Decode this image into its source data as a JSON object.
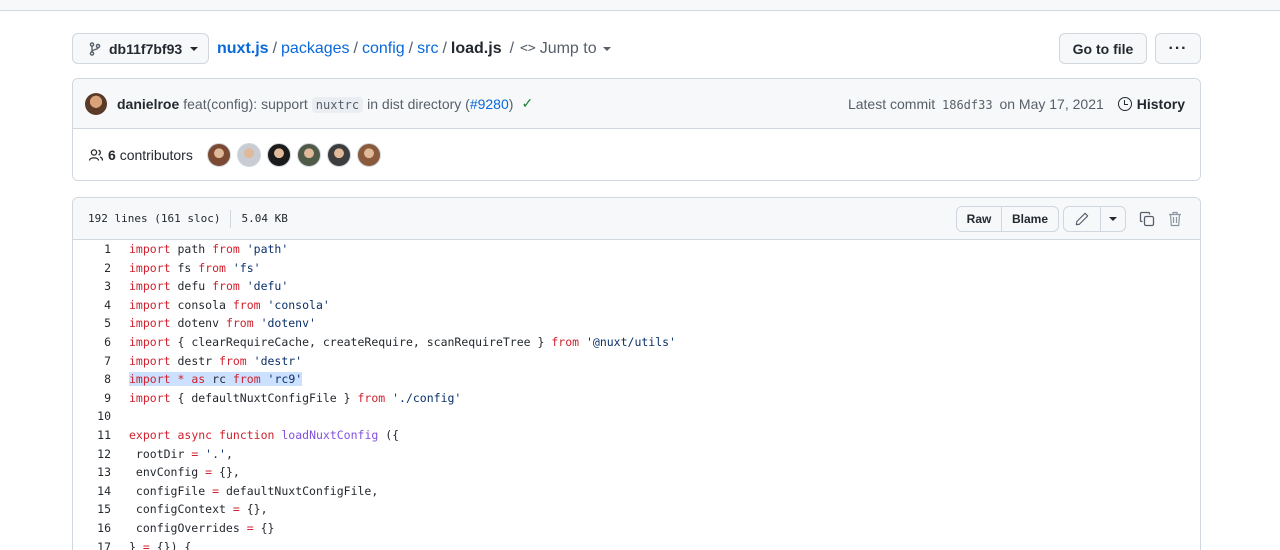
{
  "nav": {
    "branch": "db11f7bf93",
    "breadcrumb": [
      "nuxt.js",
      "packages",
      "config",
      "src"
    ],
    "filename": "load.js",
    "jump_to": "Jump to",
    "go_to_file": "Go to file",
    "more": "···"
  },
  "commit": {
    "author": "danielroe",
    "message_prefix": "feat(config): support",
    "message_code": "nuxtrc",
    "message_suffix": "in dist directory (",
    "pr": "#9280",
    "message_close": ")",
    "latest_label": "Latest commit",
    "sha": "186df33",
    "date": "on May 17, 2021",
    "history": "History"
  },
  "contributors": {
    "count": "6",
    "label": "contributors",
    "avatar_colors": [
      "#7a4b32",
      "#c9ccd3",
      "#1b1b1b",
      "#4f5a48",
      "#3d3d3d",
      "#8a5a3c"
    ]
  },
  "file": {
    "lines_info": "192 lines (161 sloc)",
    "size": "5.04 KB",
    "raw": "Raw",
    "blame": "Blame"
  },
  "code_lines": [
    {
      "n": "1",
      "parts": [
        [
          "kw",
          "import"
        ],
        [
          "",
          "  path "
        ],
        [
          "kw",
          "from"
        ],
        [
          "str",
          " 'path'"
        ]
      ]
    },
    {
      "n": "2",
      "parts": [
        [
          "kw",
          "import"
        ],
        [
          "",
          "  fs "
        ],
        [
          "kw",
          "from"
        ],
        [
          "str",
          " 'fs'"
        ]
      ]
    },
    {
      "n": "3",
      "parts": [
        [
          "kw",
          "import"
        ],
        [
          "",
          "  defu "
        ],
        [
          "kw",
          "from"
        ],
        [
          "str",
          " 'defu'"
        ]
      ]
    },
    {
      "n": "4",
      "parts": [
        [
          "kw",
          "import"
        ],
        [
          "",
          "  consola "
        ],
        [
          "kw",
          "from"
        ],
        [
          "str",
          " 'consola'"
        ]
      ]
    },
    {
      "n": "5",
      "parts": [
        [
          "kw",
          "import"
        ],
        [
          "",
          "  dotenv "
        ],
        [
          "kw",
          "from"
        ],
        [
          "str",
          " 'dotenv'"
        ]
      ]
    },
    {
      "n": "6",
      "parts": [
        [
          "kw",
          "import"
        ],
        [
          "",
          "  { clearRequireCache, createRequire, scanRequireTree } "
        ],
        [
          "kw",
          "from"
        ],
        [
          "str",
          " '@nuxt/utils'"
        ]
      ]
    },
    {
      "n": "7",
      "parts": [
        [
          "kw",
          "import"
        ],
        [
          "",
          "  destr "
        ],
        [
          "kw",
          "from"
        ],
        [
          "str",
          " 'destr'"
        ]
      ]
    },
    {
      "n": "8",
      "hl": true,
      "parts": [
        [
          "kw",
          "import"
        ],
        [
          "",
          " "
        ],
        [
          "kw",
          "*"
        ],
        [
          "",
          " "
        ],
        [
          "kw",
          "as"
        ],
        [
          "",
          " rc "
        ],
        [
          "kw",
          "from"
        ],
        [
          "str",
          " 'rc9'"
        ]
      ]
    },
    {
      "n": "9",
      "parts": [
        [
          "kw",
          "import"
        ],
        [
          "",
          "  { defaultNuxtConfigFile } "
        ],
        [
          "kw",
          "from"
        ],
        [
          "str",
          " './config'"
        ]
      ]
    },
    {
      "n": "10",
      "parts": [
        [
          "",
          ""
        ]
      ]
    },
    {
      "n": "11",
      "parts": [
        [
          "kw",
          "export"
        ],
        [
          "",
          " "
        ],
        [
          "kw",
          "async"
        ],
        [
          "",
          " "
        ],
        [
          "kw",
          "function"
        ],
        [
          "",
          " "
        ],
        [
          "fn",
          "loadNuxtConfig"
        ],
        [
          "",
          " ({"
        ]
      ]
    },
    {
      "n": "12",
      "parts": [
        [
          "",
          "  rootDir "
        ],
        [
          "kw",
          "="
        ],
        [
          "str",
          " '.'"
        ],
        [
          "",
          ","
        ]
      ]
    },
    {
      "n": "13",
      "parts": [
        [
          "",
          "  envConfig "
        ],
        [
          "kw",
          "="
        ],
        [
          "",
          " {},"
        ]
      ]
    },
    {
      "n": "14",
      "parts": [
        [
          "",
          "  configFile "
        ],
        [
          "kw",
          "="
        ],
        [
          "",
          " defaultNuxtConfigFile,"
        ]
      ]
    },
    {
      "n": "15",
      "parts": [
        [
          "",
          "  configContext "
        ],
        [
          "kw",
          "="
        ],
        [
          "",
          " {},"
        ]
      ]
    },
    {
      "n": "16",
      "parts": [
        [
          "",
          "  configOverrides "
        ],
        [
          "kw",
          "="
        ],
        [
          "",
          " {}"
        ]
      ]
    },
    {
      "n": "17",
      "parts": [
        [
          "",
          "} "
        ],
        [
          "kw",
          "="
        ],
        [
          "",
          " {}) {"
        ]
      ]
    }
  ]
}
